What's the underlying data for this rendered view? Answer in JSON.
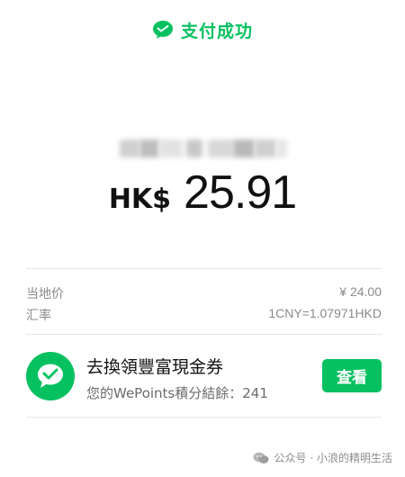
{
  "header": {
    "title": "支付成功",
    "icon": "wechat-pay-icon",
    "brand_color": "#07c160"
  },
  "merchant": {
    "name_blurred": true
  },
  "payment": {
    "currency": "HK$",
    "amount": "25.91"
  },
  "details": {
    "local_price_label": "当地价",
    "local_price_value": "¥ 24.00",
    "exchange_rate_label": "汇率",
    "exchange_rate_value": "1CNY=1.07971HKD"
  },
  "promo": {
    "icon": "wechat-chat-bubble-icon",
    "title": "去換領豐富現金券",
    "subtitle": "您的WePoints積分結餘：241",
    "button_label": "查看"
  },
  "watermark": {
    "icon": "wechat-official-account-icon",
    "text": "公众号 · 小浪的精明生活"
  }
}
